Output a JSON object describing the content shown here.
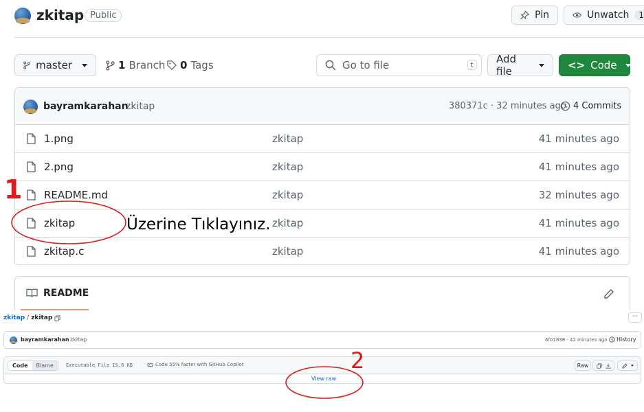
{
  "repo": {
    "name": "zkitap",
    "visibility": "Public",
    "pin_label": "Pin",
    "watch_label": "Unwatch",
    "watch_count": "1"
  },
  "toolbar": {
    "branch": "master",
    "branch_count": "1",
    "branch_word": "Branch",
    "tag_count": "0",
    "tag_word": "Tags",
    "search_placeholder": "Go to file",
    "search_shortcut": "t",
    "add_file": "Add file",
    "code": "Code"
  },
  "commit": {
    "author": "bayramkarahan",
    "message": "zkitap",
    "meta": "380371c · 32 minutes ago",
    "commits": "4 Commits"
  },
  "files": [
    {
      "name": "1.png",
      "message": "zkitap",
      "time": "41 minutes ago"
    },
    {
      "name": "2.png",
      "message": "zkitap",
      "time": "41 minutes ago"
    },
    {
      "name": "README.md",
      "message": "zkitap",
      "time": "32 minutes ago"
    },
    {
      "name": "zkitap",
      "message": "zkitap",
      "time": "41 minutes ago"
    },
    {
      "name": "zkitap.c",
      "message": "zkitap",
      "time": "41 minutes ago"
    }
  ],
  "readme": {
    "title": "README"
  },
  "annotations": {
    "step1": "1",
    "step1_text": "Üzerine Tıklayınız.",
    "step2": "2",
    "color": "#e01b1b"
  },
  "filepage": {
    "breadcrumb_repo": "zkitap",
    "breadcrumb_sep": "/",
    "breadcrumb_file": "zkitap",
    "author": "bayramkarahan",
    "message": "zkitap",
    "meta": "6f01838 · 42 minutes ago",
    "history": "History",
    "tab_code": "Code",
    "tab_blame": "Blame",
    "file_info": "Executable File  15.6 KB",
    "copilot": "Code 55% faster with GitHub Copilot",
    "raw": "Raw",
    "view_raw": "View raw"
  },
  "colors": {
    "accent_green": "#1f883d",
    "link_blue": "#0969da",
    "border": "#d1d9e0"
  }
}
